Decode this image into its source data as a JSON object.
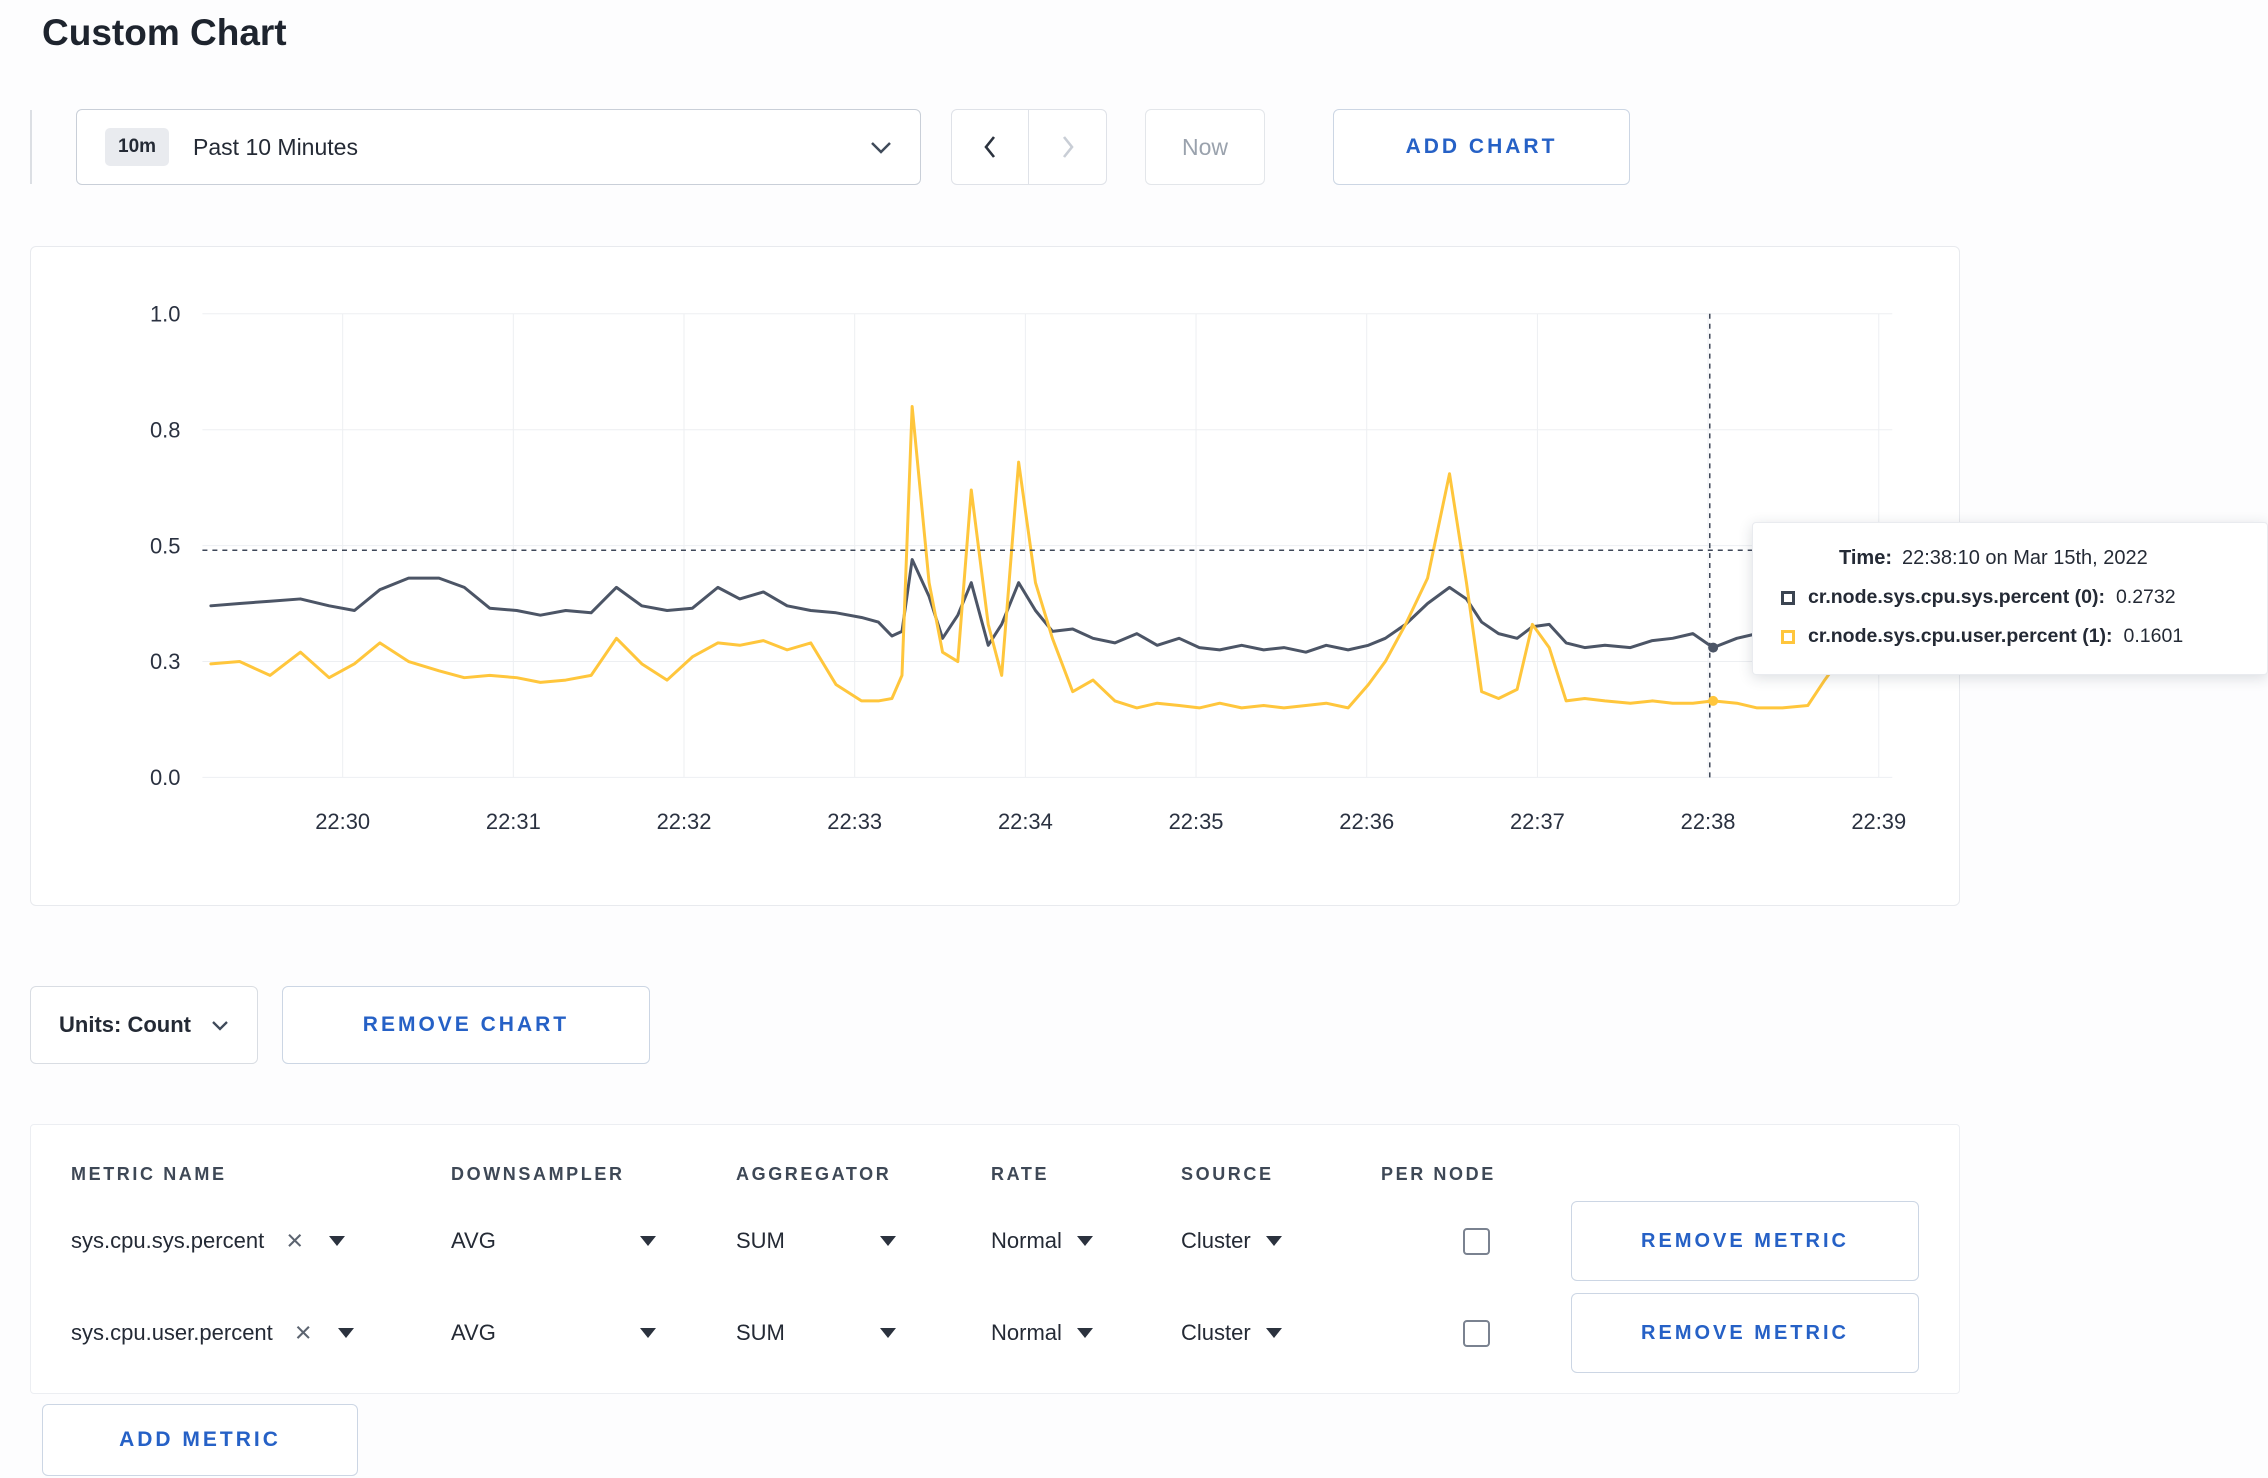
{
  "page": {
    "title": "Custom Chart"
  },
  "toolbar": {
    "time_range": {
      "badge": "10m",
      "label": "Past 10 Minutes"
    },
    "now_label": "Now",
    "add_chart_label": "ADD CHART"
  },
  "chart": {
    "tooltip": {
      "time_label": "Time:",
      "time_value": "22:38:10 on Mar 15th, 2022",
      "series_rows": [
        {
          "label": "cr.node.sys.cpu.sys.percent (0):",
          "value": "0.2732",
          "color": "#3b4451"
        },
        {
          "label": "cr.node.sys.cpu.user.percent (1):",
          "value": "0.1601",
          "color": "#ffc63c"
        }
      ]
    }
  },
  "chart_data": {
    "type": "line",
    "title": "",
    "x_axis": {
      "labels": [
        "22:30",
        "22:31",
        "22:32",
        "22:33",
        "22:34",
        "22:35",
        "22:36",
        "22:37",
        "22:38",
        "22:39"
      ],
      "tick_fracs": [
        0.083,
        0.184,
        0.285,
        0.386,
        0.487,
        0.588,
        0.689,
        0.79,
        0.891,
        0.992
      ]
    },
    "y_axis": {
      "tick_values": [
        0,
        0.25,
        0.5,
        0.75,
        1.0
      ],
      "tick_labels": [
        "0.0",
        "0.3",
        "0.5",
        "0.8",
        "1.0"
      ],
      "range": [
        0,
        1
      ]
    },
    "grid": true,
    "crosshair": {
      "x_frac": 0.892,
      "y_value": 0.49
    },
    "series": [
      {
        "name": "cr.node.sys.cpu.sys.percent",
        "color": "#4c5566",
        "points": [
          [
            0.005,
            0.37
          ],
          [
            0.022,
            0.375
          ],
          [
            0.04,
            0.38
          ],
          [
            0.058,
            0.385
          ],
          [
            0.075,
            0.37
          ],
          [
            0.09,
            0.36
          ],
          [
            0.105,
            0.405
          ],
          [
            0.122,
            0.43
          ],
          [
            0.14,
            0.43
          ],
          [
            0.155,
            0.41
          ],
          [
            0.17,
            0.365
          ],
          [
            0.186,
            0.36
          ],
          [
            0.2,
            0.35
          ],
          [
            0.215,
            0.36
          ],
          [
            0.23,
            0.355
          ],
          [
            0.245,
            0.41
          ],
          [
            0.26,
            0.37
          ],
          [
            0.275,
            0.36
          ],
          [
            0.29,
            0.365
          ],
          [
            0.305,
            0.41
          ],
          [
            0.318,
            0.385
          ],
          [
            0.332,
            0.4
          ],
          [
            0.346,
            0.37
          ],
          [
            0.36,
            0.36
          ],
          [
            0.375,
            0.355
          ],
          [
            0.39,
            0.345
          ],
          [
            0.4,
            0.335
          ],
          [
            0.408,
            0.305
          ],
          [
            0.414,
            0.315
          ],
          [
            0.42,
            0.47
          ],
          [
            0.43,
            0.39
          ],
          [
            0.438,
            0.3
          ],
          [
            0.447,
            0.35
          ],
          [
            0.455,
            0.42
          ],
          [
            0.465,
            0.285
          ],
          [
            0.473,
            0.33
          ],
          [
            0.483,
            0.42
          ],
          [
            0.493,
            0.36
          ],
          [
            0.503,
            0.315
          ],
          [
            0.515,
            0.32
          ],
          [
            0.527,
            0.3
          ],
          [
            0.54,
            0.29
          ],
          [
            0.553,
            0.31
          ],
          [
            0.565,
            0.285
          ],
          [
            0.578,
            0.3
          ],
          [
            0.59,
            0.28
          ],
          [
            0.602,
            0.275
          ],
          [
            0.615,
            0.285
          ],
          [
            0.628,
            0.275
          ],
          [
            0.64,
            0.28
          ],
          [
            0.653,
            0.27
          ],
          [
            0.665,
            0.285
          ],
          [
            0.678,
            0.275
          ],
          [
            0.69,
            0.285
          ],
          [
            0.7,
            0.3
          ],
          [
            0.712,
            0.33
          ],
          [
            0.725,
            0.375
          ],
          [
            0.738,
            0.41
          ],
          [
            0.748,
            0.385
          ],
          [
            0.757,
            0.335
          ],
          [
            0.767,
            0.31
          ],
          [
            0.778,
            0.3
          ],
          [
            0.787,
            0.325
          ],
          [
            0.797,
            0.33
          ],
          [
            0.807,
            0.29
          ],
          [
            0.818,
            0.28
          ],
          [
            0.83,
            0.285
          ],
          [
            0.845,
            0.28
          ],
          [
            0.858,
            0.295
          ],
          [
            0.87,
            0.3
          ],
          [
            0.882,
            0.31
          ],
          [
            0.894,
            0.28
          ],
          [
            0.908,
            0.3
          ],
          [
            0.92,
            0.31
          ],
          [
            0.935,
            0.3
          ],
          [
            0.95,
            0.305
          ]
        ]
      },
      {
        "name": "cr.node.sys.cpu.user.percent",
        "color": "#ffc63c",
        "points": [
          [
            0.005,
            0.245
          ],
          [
            0.022,
            0.25
          ],
          [
            0.04,
            0.22
          ],
          [
            0.058,
            0.27
          ],
          [
            0.075,
            0.215
          ],
          [
            0.09,
            0.245
          ],
          [
            0.105,
            0.29
          ],
          [
            0.122,
            0.25
          ],
          [
            0.14,
            0.23
          ],
          [
            0.155,
            0.215
          ],
          [
            0.17,
            0.22
          ],
          [
            0.186,
            0.215
          ],
          [
            0.2,
            0.205
          ],
          [
            0.215,
            0.21
          ],
          [
            0.23,
            0.22
          ],
          [
            0.245,
            0.3
          ],
          [
            0.26,
            0.245
          ],
          [
            0.275,
            0.21
          ],
          [
            0.29,
            0.26
          ],
          [
            0.305,
            0.29
          ],
          [
            0.318,
            0.285
          ],
          [
            0.332,
            0.295
          ],
          [
            0.346,
            0.275
          ],
          [
            0.36,
            0.29
          ],
          [
            0.375,
            0.2
          ],
          [
            0.39,
            0.165
          ],
          [
            0.4,
            0.165
          ],
          [
            0.408,
            0.17
          ],
          [
            0.414,
            0.22
          ],
          [
            0.42,
            0.8
          ],
          [
            0.43,
            0.42
          ],
          [
            0.438,
            0.27
          ],
          [
            0.447,
            0.25
          ],
          [
            0.455,
            0.62
          ],
          [
            0.465,
            0.33
          ],
          [
            0.473,
            0.22
          ],
          [
            0.483,
            0.68
          ],
          [
            0.493,
            0.42
          ],
          [
            0.503,
            0.3
          ],
          [
            0.515,
            0.185
          ],
          [
            0.527,
            0.21
          ],
          [
            0.54,
            0.165
          ],
          [
            0.553,
            0.15
          ],
          [
            0.565,
            0.16
          ],
          [
            0.578,
            0.155
          ],
          [
            0.59,
            0.15
          ],
          [
            0.602,
            0.16
          ],
          [
            0.615,
            0.15
          ],
          [
            0.628,
            0.155
          ],
          [
            0.64,
            0.15
          ],
          [
            0.653,
            0.155
          ],
          [
            0.665,
            0.16
          ],
          [
            0.678,
            0.15
          ],
          [
            0.69,
            0.2
          ],
          [
            0.7,
            0.25
          ],
          [
            0.712,
            0.33
          ],
          [
            0.725,
            0.43
          ],
          [
            0.738,
            0.655
          ],
          [
            0.748,
            0.42
          ],
          [
            0.757,
            0.185
          ],
          [
            0.767,
            0.17
          ],
          [
            0.778,
            0.19
          ],
          [
            0.787,
            0.33
          ],
          [
            0.797,
            0.28
          ],
          [
            0.807,
            0.165
          ],
          [
            0.818,
            0.17
          ],
          [
            0.83,
            0.165
          ],
          [
            0.845,
            0.16
          ],
          [
            0.858,
            0.165
          ],
          [
            0.87,
            0.16
          ],
          [
            0.882,
            0.16
          ],
          [
            0.894,
            0.165
          ],
          [
            0.908,
            0.16
          ],
          [
            0.92,
            0.15
          ],
          [
            0.935,
            0.15
          ],
          [
            0.95,
            0.155
          ],
          [
            0.96,
            0.21
          ],
          [
            0.972,
            0.27
          ],
          [
            0.98,
            0.25
          ]
        ]
      }
    ]
  },
  "units": {
    "label": "Units: Count",
    "remove_chart_label": "REMOVE CHART"
  },
  "table": {
    "headers": [
      "METRIC NAME",
      "DOWNSAMPLER",
      "AGGREGATOR",
      "RATE",
      "SOURCE",
      "PER NODE"
    ],
    "rows": [
      {
        "metric_name": "sys.cpu.sys.percent",
        "downsampler": "AVG",
        "aggregator": "SUM",
        "rate": "Normal",
        "source": "Cluster",
        "per_node": false,
        "remove_label": "REMOVE METRIC"
      },
      {
        "metric_name": "sys.cpu.user.percent",
        "downsampler": "AVG",
        "aggregator": "SUM",
        "rate": "Normal",
        "source": "Cluster",
        "per_node": false,
        "remove_label": "REMOVE METRIC"
      }
    ],
    "add_metric_label": "ADD METRIC"
  },
  "colors": {
    "accent_blue": "#2661c6",
    "series_sys": "#4c5566",
    "series_user": "#ffc63c"
  }
}
